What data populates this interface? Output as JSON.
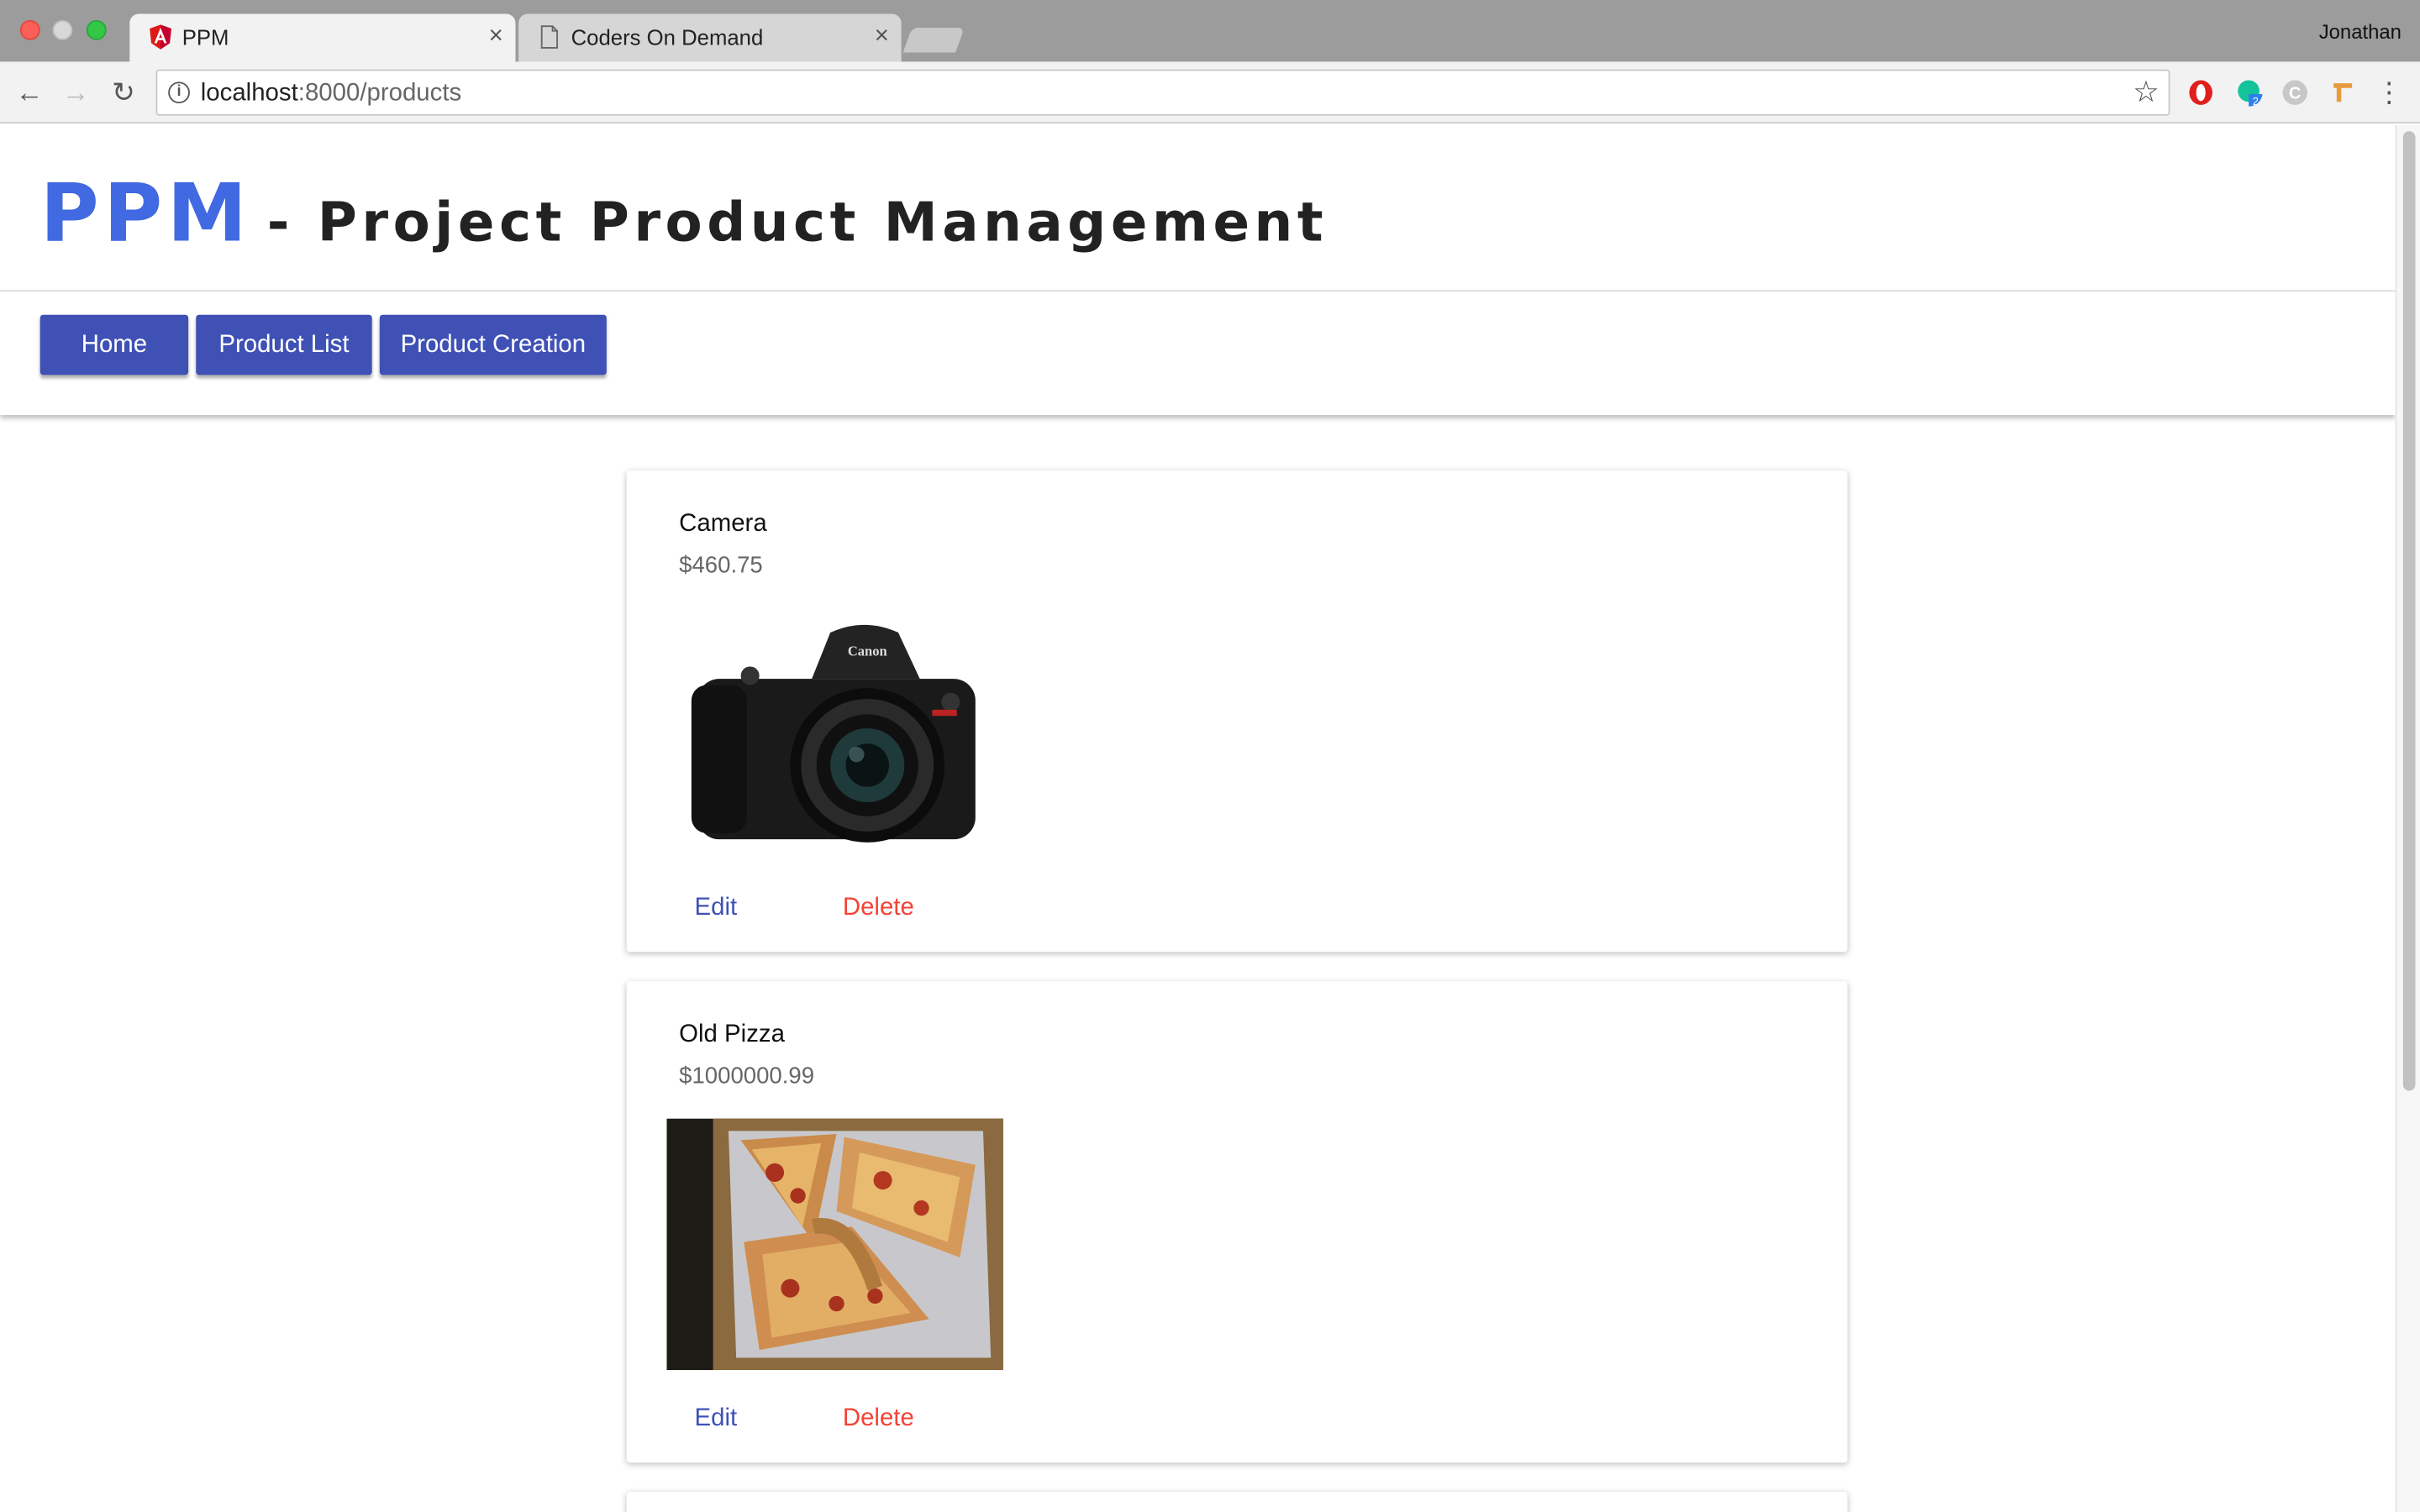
{
  "browser": {
    "tabs": [
      {
        "title": "PPM",
        "active": true
      },
      {
        "title": "Coders On Demand",
        "active": false
      }
    ],
    "profile_name": "Jonathan",
    "url_host": "localhost",
    "url_path": ":8000/products"
  },
  "header": {
    "brand": "PPM",
    "subtitle": "- Project Product Management"
  },
  "nav": {
    "home": "Home",
    "product_list": "Product List",
    "product_creation": "Product Creation"
  },
  "products": [
    {
      "name": "Camera",
      "price": "$460.75",
      "edit_label": "Edit",
      "delete_label": "Delete",
      "image": "camera"
    },
    {
      "name": "Old Pizza",
      "price": "$1000000.99",
      "edit_label": "Edit",
      "delete_label": "Delete",
      "image": "pizza"
    }
  ],
  "colors": {
    "brand": "#4169e1",
    "nav_button": "#3f51b5",
    "edit": "#3f51b5",
    "delete": "#f44336"
  }
}
